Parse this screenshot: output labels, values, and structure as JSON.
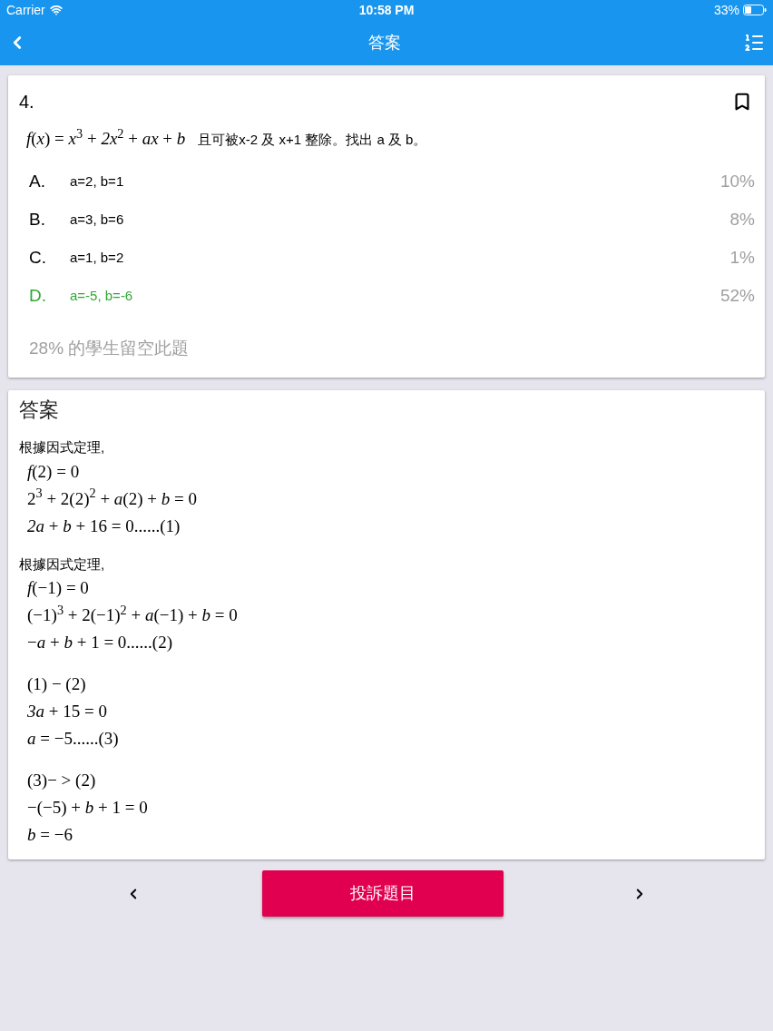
{
  "status_bar": {
    "carrier": "Carrier",
    "time": "10:58 PM",
    "battery": "33%"
  },
  "nav_bar": {
    "title": "答案"
  },
  "question": {
    "number": "4.",
    "bookmarked": false,
    "formula": "*f*(*x*) = *x*$^{3}$ + *2x*$^{2}$ + *ax* + *b*",
    "text": "且可被x-2 及 x+1 整除。找出 a 及 b。",
    "options": [
      {
        "label": "A.",
        "text": "a=2, b=1",
        "percent": "10%",
        "correct": false
      },
      {
        "label": "B.",
        "text": "a=3, b=6",
        "percent": "8%",
        "correct": false
      },
      {
        "label": "C.",
        "text": "a=1, b=2",
        "percent": "1%",
        "correct": false
      },
      {
        "label": "D.",
        "text": "a=-5, b=-6",
        "percent": "52%",
        "correct": true
      }
    ],
    "blank_note": "28% 的學生留空此題"
  },
  "answer": {
    "title": "答案",
    "steps": [
      {
        "intro": "根據因式定理,",
        "lines": [
          "*f*(2) = 0",
          "2$^{3}$ + 2(2)$^{2}$ + *a*(2) + *b* = 0",
          "*2a* + *b* + 16 = 0......(1)"
        ]
      },
      {
        "intro": "根據因式定理,",
        "lines": [
          "*f*(−1) = 0",
          "(−1)$^{3}$ + 2(−1)$^{2}$ + *a*(−1) + *b* = 0",
          "−*a* + *b* + 1 = 0......(2)"
        ]
      },
      {
        "lines": [
          "(1) − (2)",
          "*3a* + 15 = 0",
          "*a* = −5......(3)"
        ]
      },
      {
        "lines": [
          "(3)− > (2)",
          "−(−5) + *b* + 1 = 0",
          "*b* = −6"
        ]
      }
    ]
  },
  "footer": {
    "report_button": "投訴題目"
  }
}
